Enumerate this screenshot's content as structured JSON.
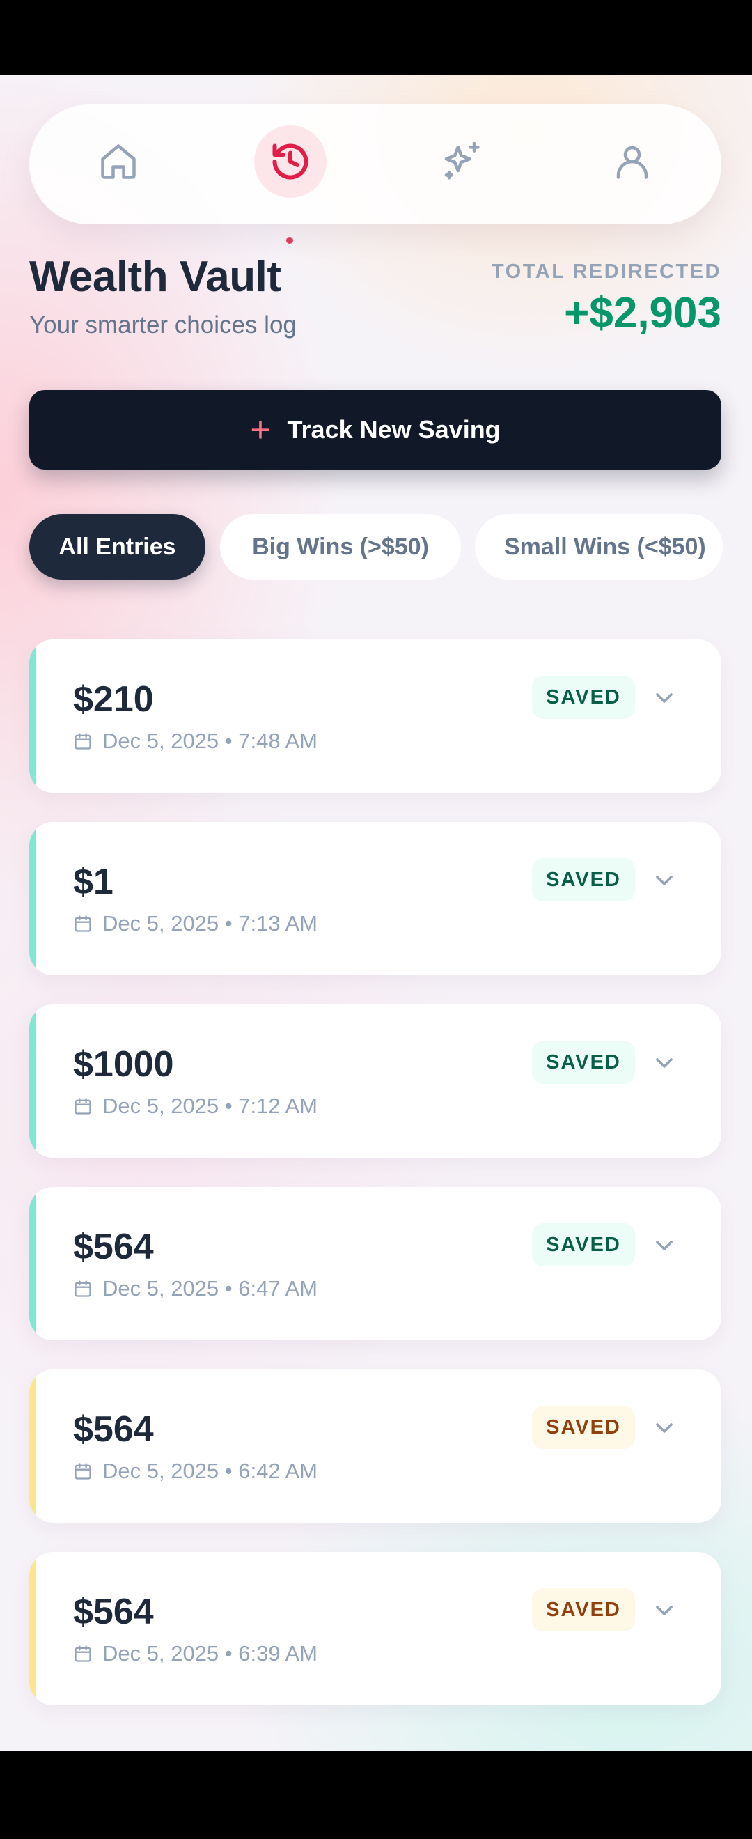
{
  "app": {
    "title": "Wealth Vault",
    "subtitle": "Your smarter choices log"
  },
  "nav": {
    "items": [
      {
        "icon": "home-icon",
        "active": false
      },
      {
        "icon": "history-icon",
        "active": true
      },
      {
        "icon": "sparkles-icon",
        "active": false
      },
      {
        "icon": "user-icon",
        "active": false
      }
    ]
  },
  "total": {
    "label": "TOTAL REDIRECTED",
    "value": "+$2,903"
  },
  "track_button": {
    "label": "Track New Saving"
  },
  "filters": [
    {
      "label": "All Entries",
      "active": true
    },
    {
      "label": "Big Wins (>$50)",
      "active": false
    },
    {
      "label": "Small Wins (<$50)",
      "active": false
    }
  ],
  "entries": [
    {
      "amount": "$210",
      "date": "Dec 5, 2025 • 7:48 AM",
      "status": "SAVED",
      "tone": "green"
    },
    {
      "amount": "$1",
      "date": "Dec 5, 2025 • 7:13 AM",
      "status": "SAVED",
      "tone": "green"
    },
    {
      "amount": "$1000",
      "date": "Dec 5, 2025 • 7:12 AM",
      "status": "SAVED",
      "tone": "green"
    },
    {
      "amount": "$564",
      "date": "Dec 5, 2025 • 6:47 AM",
      "status": "SAVED",
      "tone": "green"
    },
    {
      "amount": "$564",
      "date": "Dec 5, 2025 • 6:42 AM",
      "status": "SAVED",
      "tone": "yellow"
    },
    {
      "amount": "$564",
      "date": "Dec 5, 2025 • 6:39 AM",
      "status": "SAVED",
      "tone": "yellow"
    }
  ],
  "colors": {
    "accent_green": "#7ee8d4",
    "accent_yellow": "#fde68a",
    "total_green": "#059669",
    "active_nav": "#e23a58",
    "dark": "#111827"
  }
}
